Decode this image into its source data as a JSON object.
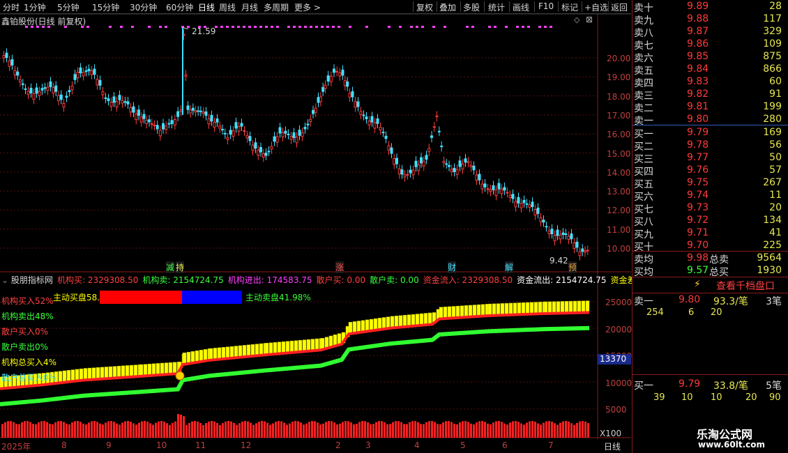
{
  "toolbar": {
    "items": [
      "分时",
      "1分钟",
      "5分钟",
      "15分钟",
      "30分钟",
      "60分钟",
      "日线",
      "周线",
      "月线",
      "多周期",
      "更多 >"
    ],
    "right_items": [
      "复权",
      "叠加",
      "多股",
      "统计",
      "画线",
      "F10",
      "标记",
      "+自选",
      "返回"
    ]
  },
  "stock": {
    "title": "鑫铂股份(日线 前复权)",
    "high_marker": "21.59",
    "low_marker": "9.42"
  },
  "price_axis": [
    "20.00",
    "19.00",
    "18.00",
    "17.00",
    "16.00",
    "15.00",
    "14.00",
    "13.00",
    "12.00",
    "11.00",
    "10.00"
  ],
  "event_markers": [
    "减",
    "持",
    "涨",
    "财",
    "解",
    "预"
  ],
  "indicator": {
    "name": "股朋指标网",
    "fields": [
      {
        "label": "机构买: 2329308.50",
        "color": "#ff4040"
      },
      {
        "label": "机构卖: 2154724.75",
        "color": "#3aff3a"
      },
      {
        "label": "机构进出: 174583.75",
        "color": "#ff40ff"
      },
      {
        "label": "散户买: 0.00",
        "color": "#ff4040"
      },
      {
        "label": "散户卖: 0.00",
        "color": "#3aff3a"
      },
      {
        "label": "资金流入: 2329308.50",
        "color": "#ff4040"
      },
      {
        "label": "资金流出: 2154724.75",
        "color": "#ffffff"
      },
      {
        "label": "资金差",
        "color": "#ffff00"
      }
    ],
    "active_buy_label": "主动买盘58.02%",
    "active_sell_label": "主动卖盘41.98%",
    "side_labels": [
      {
        "text": "机构买入52%",
        "color": "#ff4040"
      },
      {
        "text": "机构卖出48%",
        "color": "#3aff3a"
      },
      {
        "text": "散户买入0%",
        "color": "#ff4040"
      },
      {
        "text": "散户卖出0%",
        "color": "#3aff3a"
      },
      {
        "text": "机构总买入4%",
        "color": "#ffff00"
      },
      {
        "text": "散户总买入0%",
        "color": "#40e0ff"
      }
    ],
    "axis": [
      "25000",
      "20000",
      "15000",
      "10000",
      "5000"
    ],
    "highlight_value": "13370",
    "x100": "X100"
  },
  "date_axis": [
    "2025年",
    "8",
    "9",
    "10",
    "11",
    "12",
    "2",
    "3",
    "4",
    "5",
    "6",
    "7"
  ],
  "period_label": "日线",
  "order_book": {
    "asks": [
      {
        "name": "卖十",
        "price": "9.89",
        "vol": "28"
      },
      {
        "name": "卖九",
        "price": "9.88",
        "vol": "117"
      },
      {
        "name": "卖八",
        "price": "9.87",
        "vol": "329"
      },
      {
        "name": "卖七",
        "price": "9.86",
        "vol": "109"
      },
      {
        "name": "卖六",
        "price": "9.85",
        "vol": "875"
      },
      {
        "name": "卖五",
        "price": "9.84",
        "vol": "866"
      },
      {
        "name": "卖四",
        "price": "9.83",
        "vol": "60"
      },
      {
        "name": "卖三",
        "price": "9.82",
        "vol": "91"
      },
      {
        "name": "卖二",
        "price": "9.81",
        "vol": "199"
      },
      {
        "name": "卖一",
        "price": "9.80",
        "vol": "280"
      }
    ],
    "bids": [
      {
        "name": "买一",
        "price": "9.79",
        "vol": "169"
      },
      {
        "name": "买二",
        "price": "9.78",
        "vol": "56"
      },
      {
        "name": "买三",
        "price": "9.77",
        "vol": "50"
      },
      {
        "name": "买四",
        "price": "9.76",
        "vol": "57"
      },
      {
        "name": "买五",
        "price": "9.75",
        "vol": "267"
      },
      {
        "name": "买六",
        "price": "9.74",
        "vol": "11"
      },
      {
        "name": "买七",
        "price": "9.73",
        "vol": "20"
      },
      {
        "name": "买八",
        "price": "9.72",
        "vol": "134"
      },
      {
        "name": "买九",
        "price": "9.71",
        "vol": "41"
      },
      {
        "name": "买十",
        "price": "9.70",
        "vol": "225"
      }
    ],
    "avg_sell_label": "卖均",
    "avg_sell": "9.98",
    "total_sell_label": "总卖",
    "total_sell": "9564",
    "avg_buy_label": "买均",
    "avg_buy": "9.57",
    "total_buy_label": "总买",
    "total_buy": "1930",
    "view_1000_label": "查看千档盘口",
    "sell1_label": "卖一",
    "sell1_price": "9.80",
    "sell1_avg": "93.3/笔",
    "sell1_count": "3笔",
    "sell1_queue": [
      "254",
      "6",
      "20"
    ],
    "buy1_label": "买一",
    "buy1_price": "9.79",
    "buy1_avg": "33.8/笔",
    "buy1_count": "5笔",
    "buy1_queue": [
      "39",
      "10",
      "10",
      "20",
      "90"
    ]
  },
  "watermark": {
    "line1": "乐淘公式网",
    "line2": "www.60lt.com"
  },
  "colors": {
    "up": "#ff3b3b",
    "down": "#3aff3a",
    "cyan": "#40e0ff",
    "yellow": "#ffff00",
    "magenta": "#ff40ff"
  }
}
